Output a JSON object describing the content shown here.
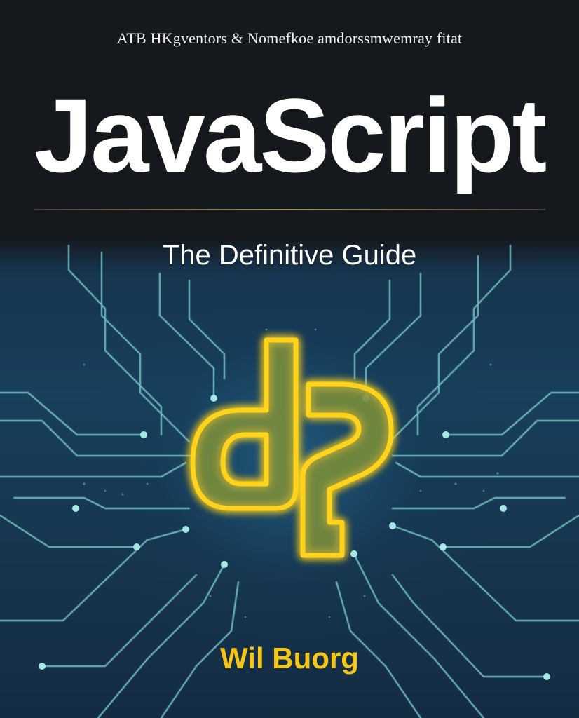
{
  "cover": {
    "tagline": "ATB HKgventors & Nomefkoe amdorssmwemray fitat",
    "title": "JavaScript",
    "subtitle": "The Definitive Guide",
    "logo_icon": "js-logo-icon",
    "author": "Wil Buorg",
    "colors": {
      "background_top": "#15181c",
      "background_bottom": "#183f5c",
      "circuit_lines": "#7fd3d6",
      "logo_glow": "#ffd21a",
      "author_text": "#f5c518"
    }
  }
}
